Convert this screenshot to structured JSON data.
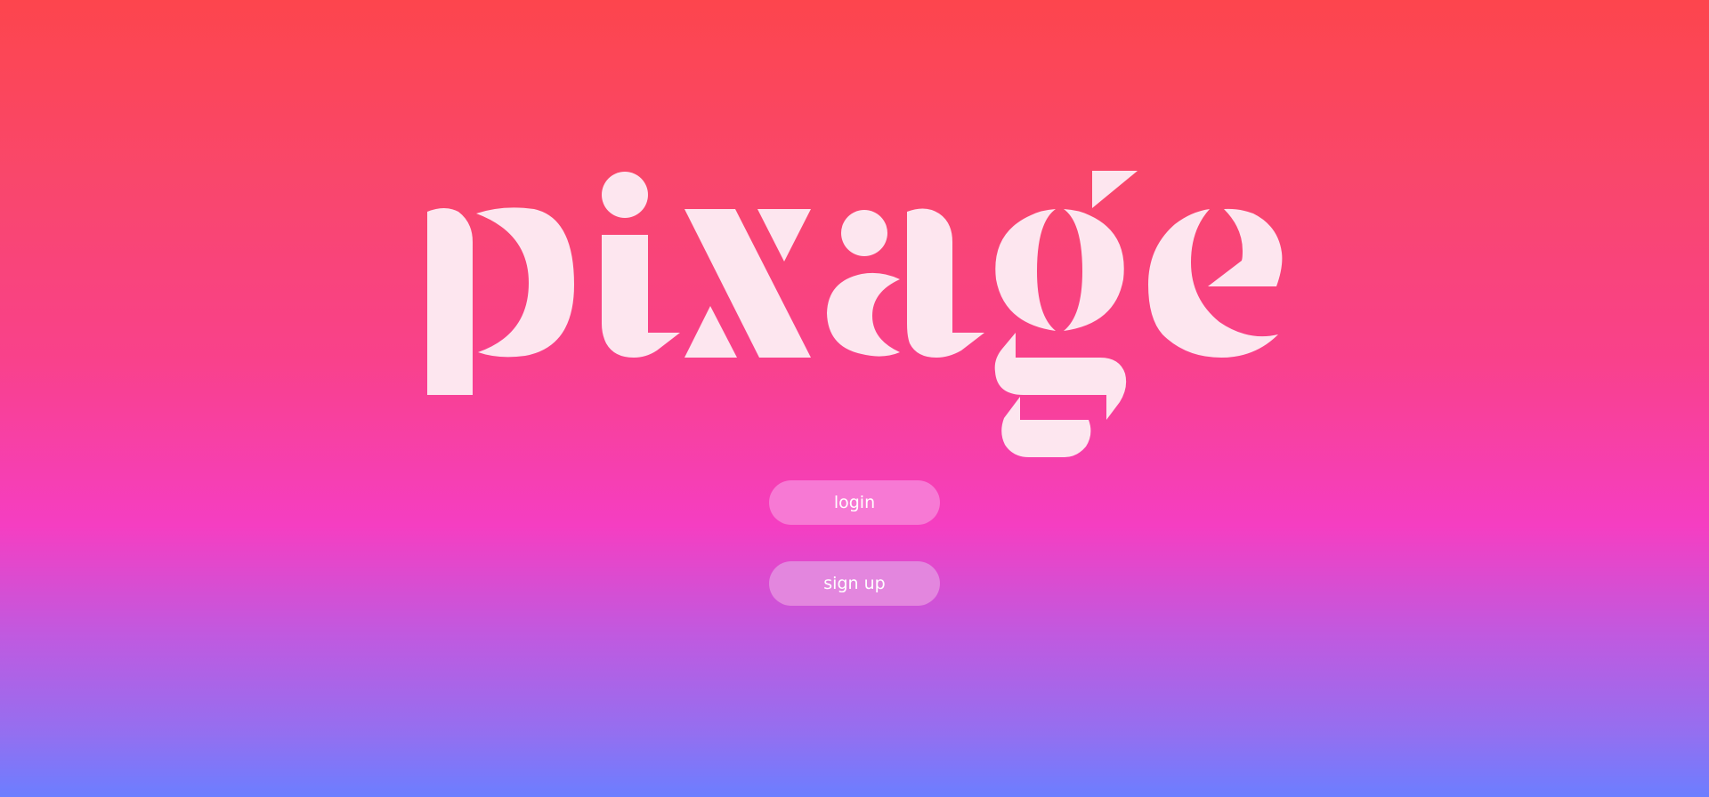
{
  "app": {
    "logo_text": "pixage",
    "logo_color": "#fde6ef"
  },
  "auth": {
    "login_label": "login",
    "signup_label": "sign up"
  },
  "colors": {
    "gradient_top": "#fd454d",
    "gradient_middle": "#f53ec2",
    "gradient_bottom": "#6c7eff",
    "login_button": "#f779d4",
    "signup_button": "#e386de"
  }
}
